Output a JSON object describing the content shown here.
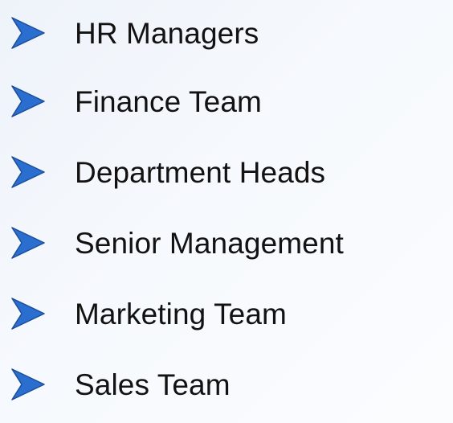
{
  "theme": {
    "arrow_fill": "#2a6fd0",
    "arrow_stroke": "#1c4d9a",
    "text_color": "#121212"
  },
  "bullets": {
    "icon": "arrow-bullet-icon",
    "items": [
      {
        "label": "HR Managers"
      },
      {
        "label": "Finance Team"
      },
      {
        "label": "Department Heads"
      },
      {
        "label": "Senior Management"
      },
      {
        "label": "Marketing Team"
      },
      {
        "label": "Sales Team"
      }
    ]
  }
}
